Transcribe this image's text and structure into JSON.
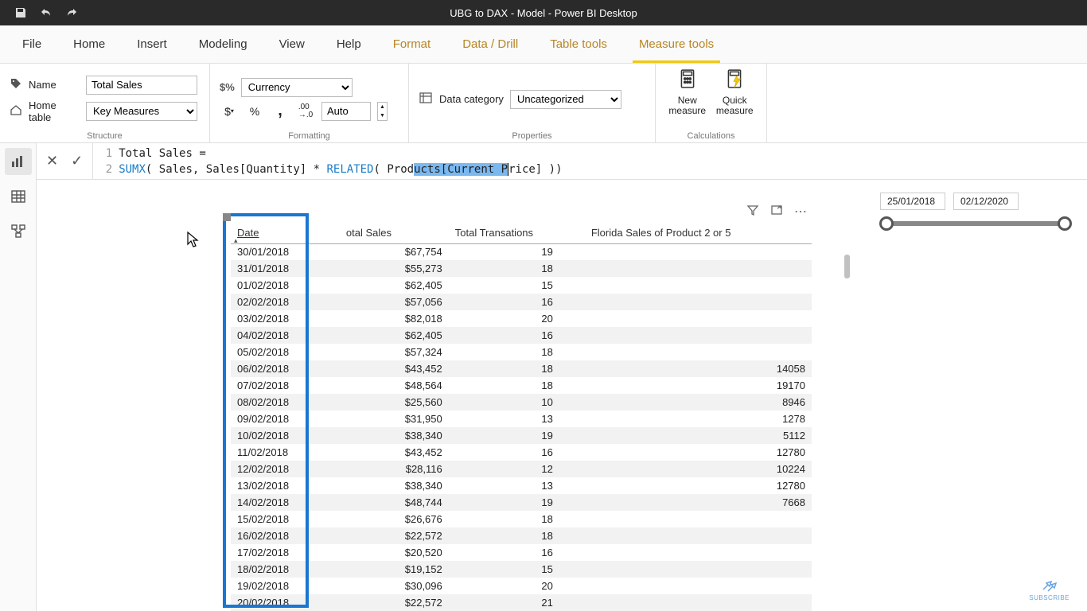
{
  "app": {
    "title": "UBG to DAX - Model - Power BI Desktop"
  },
  "tabs": {
    "file": "File",
    "home": "Home",
    "insert": "Insert",
    "modeling": "Modeling",
    "view": "View",
    "help": "Help",
    "format": "Format",
    "datadrill": "Data / Drill",
    "tabletools": "Table tools",
    "measuretools": "Measure tools"
  },
  "ribbon": {
    "structure": {
      "label": "Structure",
      "name_label": "Name",
      "name_value": "Total Sales",
      "hometable_label": "Home table",
      "hometable_value": "Key Measures"
    },
    "formatting": {
      "label": "Formatting",
      "format_value": "Currency",
      "decimals_value": "Auto",
      "pct": "%",
      "comma": ",",
      "dec_inc": ".00",
      "dec_dec": "→0"
    },
    "properties": {
      "label": "Properties",
      "datacat_label": "Data category",
      "datacat_value": "Uncategorized"
    },
    "calculations": {
      "label": "Calculations",
      "new_measure": "New measure",
      "quick_measure": "Quick measure"
    }
  },
  "formula": {
    "line1_num": "1",
    "line2_num": "2",
    "line1": "Total Sales =",
    "sumx": "SUMX",
    "mid": "( Sales, Sales[Quantity] * ",
    "related": "RELATED",
    "open": "( ",
    "col_pre": "Prod",
    "col_hl": "ucts[Current P",
    "col_post": "rice]",
    "close": " ))"
  },
  "slicer": {
    "start": "25/01/2018",
    "end": "02/12/2020"
  },
  "table": {
    "headers": {
      "date": "Date",
      "sales": "otal Sales",
      "trans": "Total Transations",
      "florida": "Florida Sales of Product 2 or 5"
    },
    "rows": [
      {
        "date": "30/01/2018",
        "sales": "$67,754",
        "trans": "19",
        "florida": ""
      },
      {
        "date": "31/01/2018",
        "sales": "$55,273",
        "trans": "18",
        "florida": ""
      },
      {
        "date": "01/02/2018",
        "sales": "$62,405",
        "trans": "15",
        "florida": ""
      },
      {
        "date": "02/02/2018",
        "sales": "$57,056",
        "trans": "16",
        "florida": ""
      },
      {
        "date": "03/02/2018",
        "sales": "$82,018",
        "trans": "20",
        "florida": ""
      },
      {
        "date": "04/02/2018",
        "sales": "$62,405",
        "trans": "16",
        "florida": ""
      },
      {
        "date": "05/02/2018",
        "sales": "$57,324",
        "trans": "18",
        "florida": ""
      },
      {
        "date": "06/02/2018",
        "sales": "$43,452",
        "trans": "18",
        "florida": "14058"
      },
      {
        "date": "07/02/2018",
        "sales": "$48,564",
        "trans": "18",
        "florida": "19170"
      },
      {
        "date": "08/02/2018",
        "sales": "$25,560",
        "trans": "10",
        "florida": "8946"
      },
      {
        "date": "09/02/2018",
        "sales": "$31,950",
        "trans": "13",
        "florida": "1278"
      },
      {
        "date": "10/02/2018",
        "sales": "$38,340",
        "trans": "19",
        "florida": "5112"
      },
      {
        "date": "11/02/2018",
        "sales": "$43,452",
        "trans": "16",
        "florida": "12780"
      },
      {
        "date": "12/02/2018",
        "sales": "$28,116",
        "trans": "12",
        "florida": "10224"
      },
      {
        "date": "13/02/2018",
        "sales": "$38,340",
        "trans": "13",
        "florida": "12780"
      },
      {
        "date": "14/02/2018",
        "sales": "$48,744",
        "trans": "19",
        "florida": "7668"
      },
      {
        "date": "15/02/2018",
        "sales": "$26,676",
        "trans": "18",
        "florida": ""
      },
      {
        "date": "16/02/2018",
        "sales": "$22,572",
        "trans": "18",
        "florida": ""
      },
      {
        "date": "17/02/2018",
        "sales": "$20,520",
        "trans": "16",
        "florida": ""
      },
      {
        "date": "18/02/2018",
        "sales": "$19,152",
        "trans": "15",
        "florida": ""
      },
      {
        "date": "19/02/2018",
        "sales": "$30,096",
        "trans": "20",
        "florida": ""
      },
      {
        "date": "20/02/2018",
        "sales": "$22,572",
        "trans": "21",
        "florida": ""
      }
    ]
  },
  "watermark": "SUBSCRIBE"
}
